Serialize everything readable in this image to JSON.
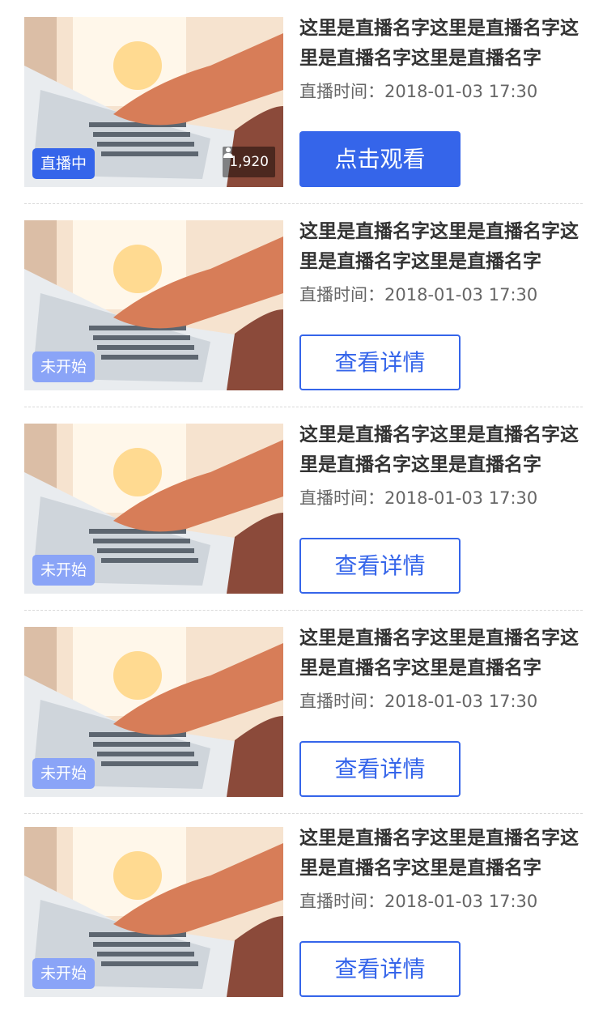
{
  "colors": {
    "accent": "#3565ea",
    "pending_badge": "#8aa4f7",
    "title_text": "#333333",
    "meta_text": "#666666"
  },
  "items": [
    {
      "title": "这里是直播名字这里是直播名字这里是直播名字这里是直播名字",
      "time_label": "直播时间：",
      "time": "2018-01-03 17:30",
      "status": "直播中",
      "viewers": "1,920",
      "button_label": "点击观看"
    },
    {
      "title": "这里是直播名字这里是直播名字这里是直播名字这里是直播名字",
      "time_label": "直播时间：",
      "time": "2018-01-03 17:30",
      "status": "未开始",
      "button_label": "查看详情"
    },
    {
      "title": "这里是直播名字这里是直播名字这里是直播名字这里是直播名字",
      "time_label": "直播时间：",
      "time": "2018-01-03 17:30",
      "status": "未开始",
      "button_label": "查看详情"
    },
    {
      "title": "这里是直播名字这里是直播名字这里是直播名字这里是直播名字",
      "time_label": "直播时间：",
      "time": "2018-01-03 17:30",
      "status": "未开始",
      "button_label": "查看详情"
    },
    {
      "title": "这里是直播名字这里是直播名字这里是直播名字这里是直播名字",
      "time_label": "直播时间：",
      "time": "2018-01-03 17:30",
      "status": "未开始",
      "button_label": "查看详情"
    }
  ]
}
